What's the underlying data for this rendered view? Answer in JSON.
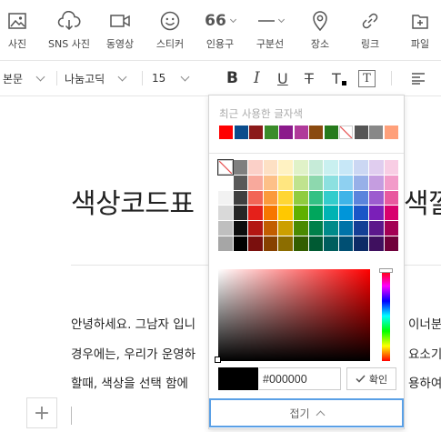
{
  "toolbar": {
    "items": [
      {
        "label": "사진",
        "icon": "photo-icon"
      },
      {
        "label": "SNS 사진",
        "icon": "cloud-icon"
      },
      {
        "label": "동영상",
        "icon": "video-icon"
      },
      {
        "label": "스티커",
        "icon": "sticker-icon"
      },
      {
        "label": "인용구",
        "icon": "quote-icon",
        "glyph": "66"
      },
      {
        "label": "구분선",
        "icon": "divider-icon"
      },
      {
        "label": "장소",
        "icon": "location-icon"
      },
      {
        "label": "링크",
        "icon": "link-icon"
      },
      {
        "label": "파일",
        "icon": "file-icon"
      }
    ]
  },
  "format": {
    "paragraph_style": "본문",
    "font": "나눔고딕",
    "font_size": "15",
    "bold_glyph": "B",
    "italic_glyph": "I",
    "underline_glyph": "U",
    "strike_glyph": "T",
    "text_color_glyph": "T",
    "text_bg_glyph": "T"
  },
  "editor": {
    "title_left": "색상코드표",
    "title_right": "색깔",
    "paragraphs": [
      {
        "left": "안녕하세요. 그남자 입니",
        "right": "이너분"
      },
      {
        "left": "경우에는, 우리가 운영하",
        "right": "요소기"
      },
      {
        "left": "할때, 색상을 선택 함에",
        "right": "용하여"
      }
    ]
  },
  "color_picker": {
    "recent_label": "최근 사용한 글자색",
    "recent_colors": [
      "#ff0000",
      "#0a4c8c",
      "#8b1a1a",
      "#3a8c2a",
      "#8b1a8b",
      "#b03a9a",
      "#8a4a10",
      "#267a1c",
      "none",
      "#555555",
      "#888888",
      "#ffa07a"
    ],
    "palette": [
      [
        "none",
        "#7f7f7f",
        "#fbd0c8",
        "#fde0c4",
        "#fff2c2",
        "#e0f2c8",
        "#c6ebd8",
        "#c9f0f0",
        "#c7e7f7",
        "#cbd7f3",
        "#e0cdef",
        "#f8cde4"
      ],
      [
        "#ffffff",
        "#595959",
        "#f8a99c",
        "#fdc088",
        "#ffe680",
        "#c0e38e",
        "#8dd8ae",
        "#8ce0e0",
        "#8ed0f1",
        "#97b0e8",
        "#c59de0",
        "#f29bc9"
      ],
      [
        "#f2f2f2",
        "#404040",
        "#f26556",
        "#fb9a3c",
        "#ffd633",
        "#8fcc3f",
        "#33c184",
        "#33cccc",
        "#3fb4e8",
        "#5b84dc",
        "#9c5ccf",
        "#e8599f"
      ],
      [
        "#d9d9d9",
        "#262626",
        "#e5201a",
        "#f77600",
        "#ffc800",
        "#5fb000",
        "#00a65c",
        "#00b3b3",
        "#0095d9",
        "#1a56c7",
        "#7a1fb8",
        "#d8006e"
      ],
      [
        "#bfbfbf",
        "#0d0d0d",
        "#b31612",
        "#c25d00",
        "#cc9f00",
        "#4a8a00",
        "#00804a",
        "#008a8a",
        "#0073a8",
        "#143f95",
        "#5c178b",
        "#a30054"
      ],
      [
        "#a6a6a6",
        "#000000",
        "#7a0f0d",
        "#874100",
        "#8c6d00",
        "#335e00",
        "#005a33",
        "#005e5e",
        "#004f73",
        "#0d2b66",
        "#3f105f",
        "#70003a"
      ]
    ],
    "hue": "#ff0000",
    "current_color": "#000000",
    "hex_value": "#000000",
    "confirm_label": "확인",
    "collapse_label": "접기"
  }
}
